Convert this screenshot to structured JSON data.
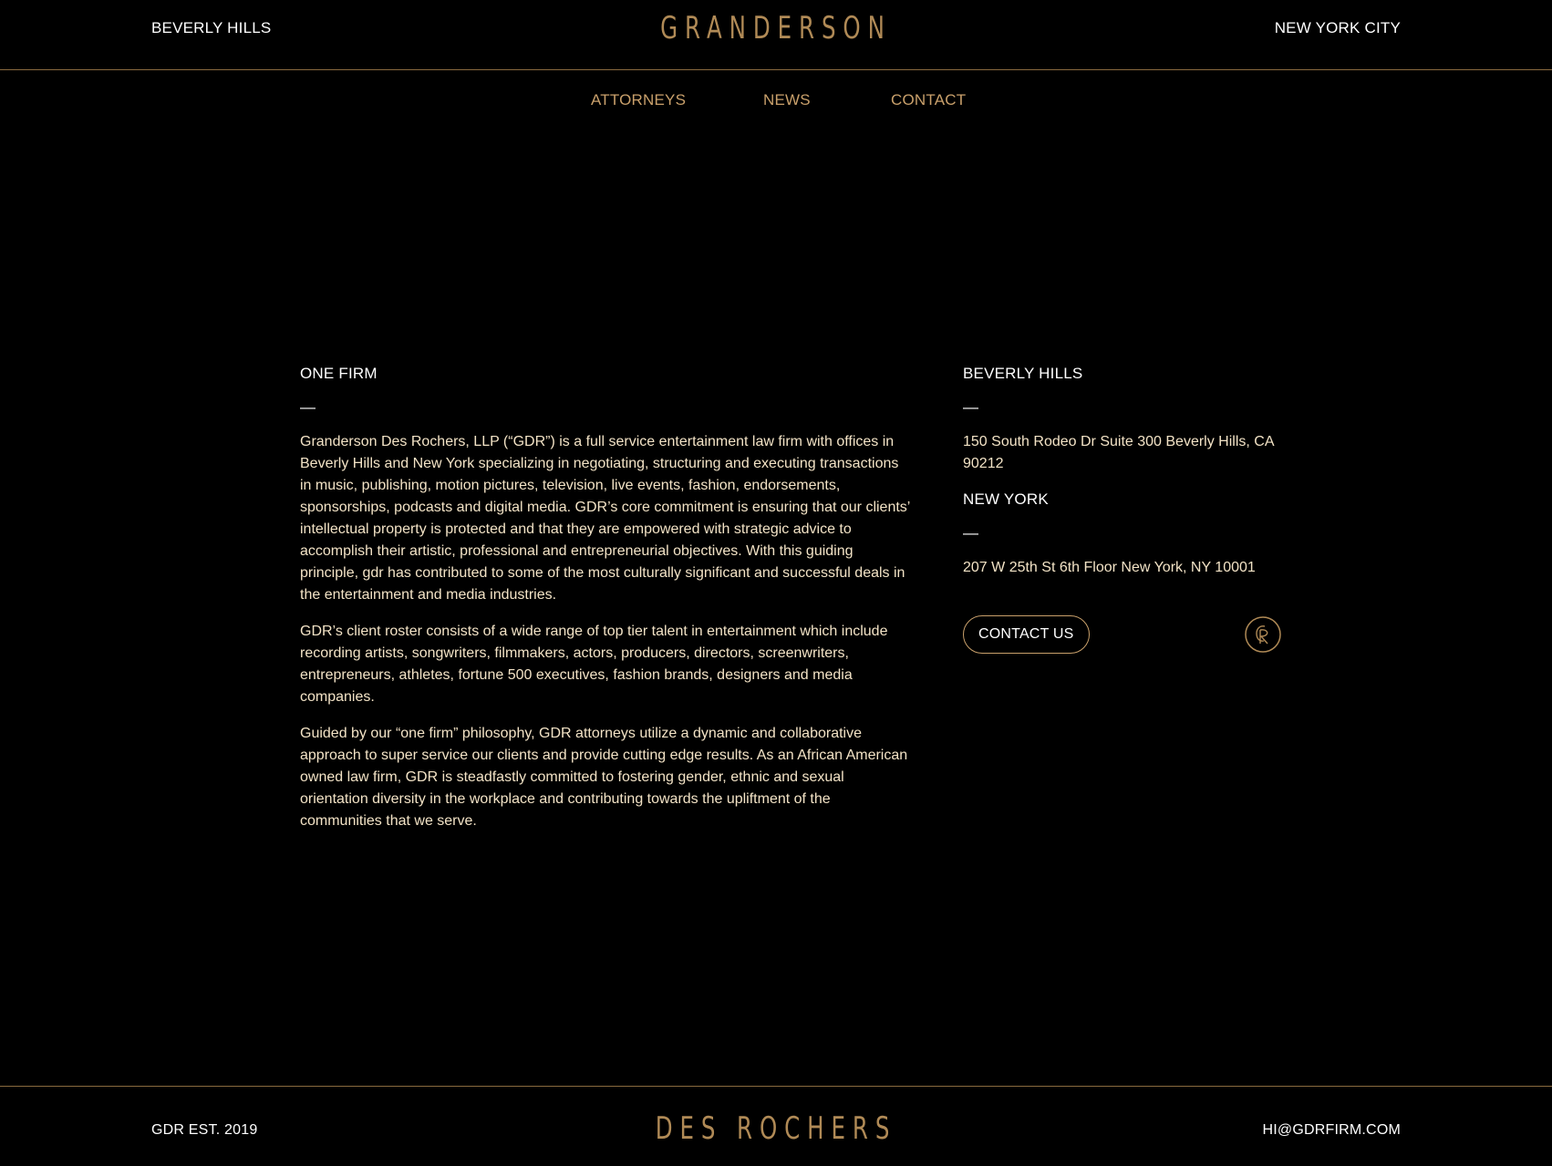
{
  "header": {
    "left_location": "BEVERLY HILLS",
    "logo_text": "GRANDERSON",
    "right_location": "NEW YORK CITY"
  },
  "nav": {
    "items": [
      {
        "label": "ATTORNEYS"
      },
      {
        "label": "NEWS"
      },
      {
        "label": "CONTACT"
      }
    ]
  },
  "about": {
    "heading": "ONE FIRM",
    "dash": "—",
    "paragraphs": [
      "Granderson Des Rochers, LLP (“GDR”) is a full service entertainment law firm with offices in Beverly Hills and New York specializing in negotiating, structuring and executing transactions in music, publishing, motion pictures, television, live events, fashion, endorsements, sponsorships, podcasts and digital media. GDR’s core commitment is ensuring that our clients’ intellectual property is protected and that they are empowered with strategic advice to accomplish their artistic, professional and entrepreneurial objectives. With this guiding principle, gdr has contributed to some of the most culturally significant and successful deals in the entertainment and media industries.",
      "GDR’s client roster consists of a wide range of top tier talent in entertainment which include recording artists, songwriters, filmmakers, actors, producers, directors, screenwriters, entrepreneurs, athletes, fortune 500 executives, fashion brands, designers and media companies.",
      "Guided by our “one firm” philosophy, GDR attorneys utilize a dynamic and collaborative approach to super service our clients and provide cutting edge results. As an African American owned law firm, GDR is steadfastly committed to fostering gender, ethnic and sexual orientation diversity in the workplace and contributing towards the upliftment of the communities that we serve."
    ]
  },
  "offices": {
    "beverly_hills": {
      "heading": "BEVERLY HILLS",
      "dash": "—",
      "address": "150 South Rodeo Dr Suite 300 Beverly Hills, CA 90212"
    },
    "new_york": {
      "heading": "NEW YORK",
      "dash": "—",
      "address": "207 W 25th St 6th Floor New York, NY 10001"
    }
  },
  "actions": {
    "contact_button": "CONTACT US",
    "monogram_icon": "gdr-monogram-icon"
  },
  "footer": {
    "left_text": "GDR EST. 2019",
    "logo_text": "DES ROCHERS",
    "email": "HI@GDRFIRM.COM"
  },
  "colors": {
    "background": "#000000",
    "gold": "#b08a56",
    "nav_gold": "#c9a06b",
    "body_text": "#f3e3c6",
    "rule": "#8a6a3f"
  }
}
